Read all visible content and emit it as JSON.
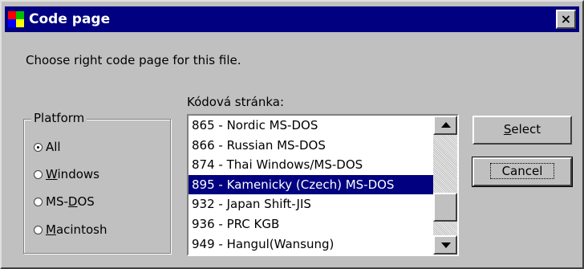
{
  "window": {
    "title": "Code page",
    "close_label": "×",
    "icon": "app-flag-icon"
  },
  "prompt": "Choose right code page for this file.",
  "platform": {
    "legend": "Platform",
    "options": [
      {
        "pre": "",
        "key": "",
        "post": "All",
        "selected": true
      },
      {
        "pre": "",
        "key": "W",
        "post": "indows",
        "selected": false
      },
      {
        "pre": "MS-",
        "key": "D",
        "post": "OS",
        "selected": false
      },
      {
        "pre": "",
        "key": "M",
        "post": "acintosh",
        "selected": false
      }
    ]
  },
  "codepage": {
    "label": "Kódová stránka:",
    "items": [
      "865 - Nordic MS-DOS",
      "866 - Russian MS-DOS",
      "874 - Thai Windows/MS-DOS",
      "895 - Kamenicky (Czech) MS-DOS",
      "932 - Japan Shift-JIS",
      "936 - PRC KGB",
      "949 - Hangul(Wansung)"
    ],
    "selected_index": 3
  },
  "buttons": {
    "select": {
      "pre": "",
      "key": "S",
      "post": "elect"
    },
    "cancel": {
      "label": "Cancel"
    }
  },
  "colors": {
    "titlebar": "#000080",
    "selection": "#000080",
    "face": "#c0c0c0"
  }
}
